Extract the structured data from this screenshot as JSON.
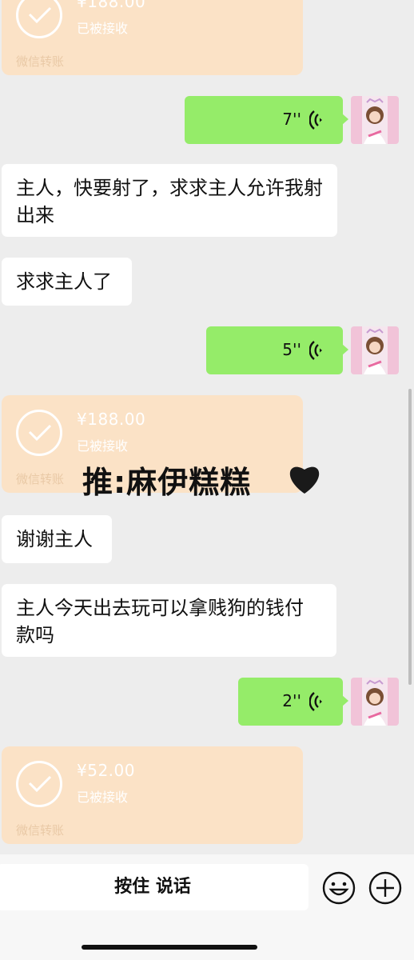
{
  "transfers": [
    {
      "amount": "¥188.00",
      "status": "已被接收",
      "footer": "微信转账"
    },
    {
      "amount": "¥188.00",
      "status": "已被接收",
      "footer": "微信转账"
    },
    {
      "amount": "¥52.00",
      "status": "已被接收",
      "footer": "微信转账"
    }
  ],
  "voice_messages": [
    {
      "duration": "7''"
    },
    {
      "duration": "5''"
    },
    {
      "duration": "2''"
    }
  ],
  "text_messages": [
    {
      "text": "主人，快要射了，求求主人允许我射出来"
    },
    {
      "text": "求求主人了"
    },
    {
      "text": "谢谢主人"
    },
    {
      "text": "主人今天出去玩可以拿贱狗的钱付款吗"
    }
  ],
  "watermark": {
    "text": "推:麻伊糕糕"
  },
  "input_bar": {
    "hold_to_talk": "按住 说话",
    "emoji_icon": "emoji-icon",
    "plus_icon": "plus-icon"
  },
  "colors": {
    "background": "#ededed",
    "outgoing_bubble": "#95ec69",
    "incoming_bubble": "#ffffff",
    "transfer_card": "#fbe2c6"
  }
}
